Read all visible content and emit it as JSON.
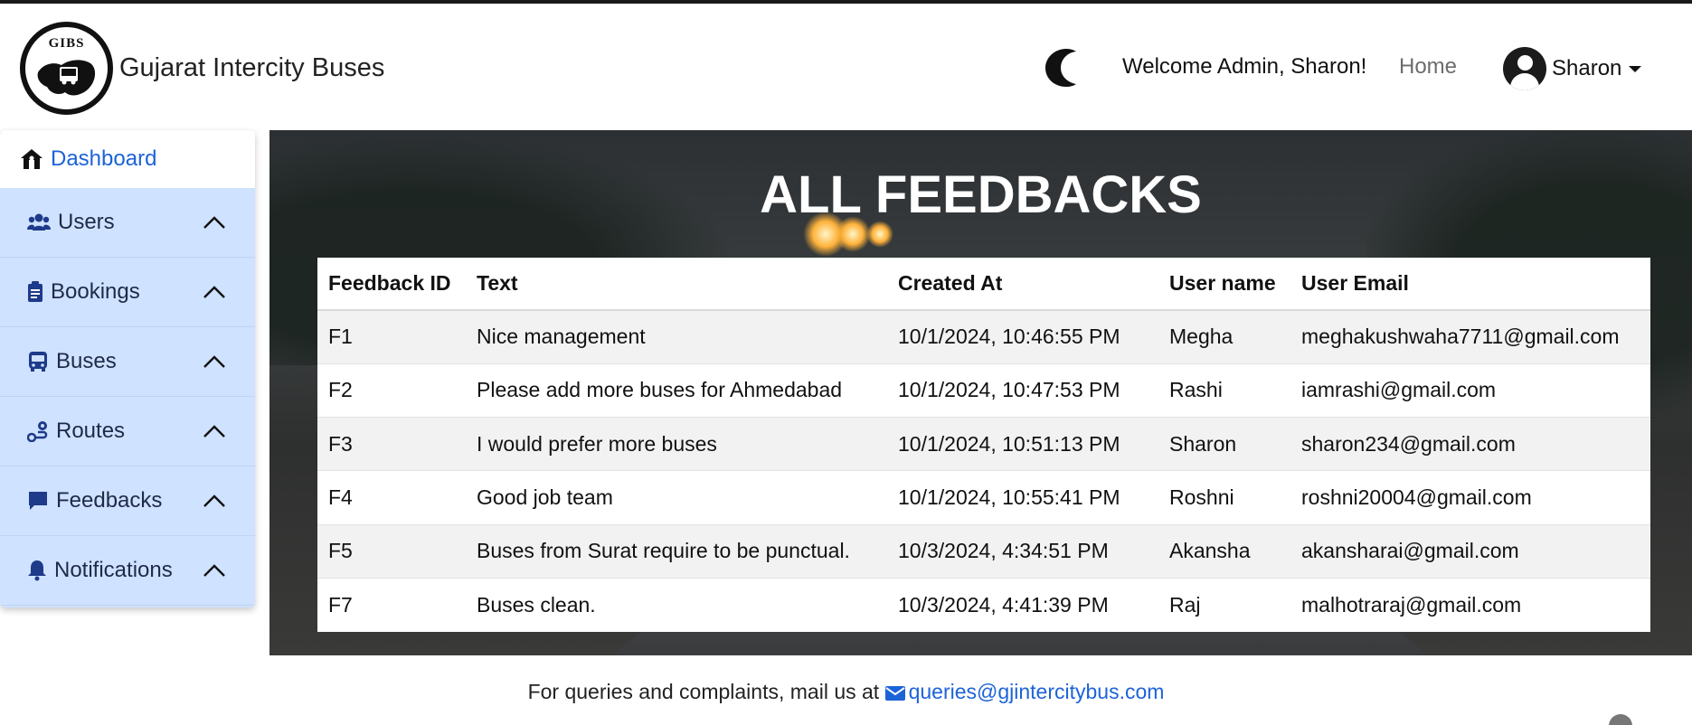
{
  "brand": {
    "logo_text": "GIBS",
    "name": "Gujarat Intercity Buses"
  },
  "nav": {
    "welcome": "Welcome Admin, Sharon!",
    "home": "Home",
    "user_name": "Sharon"
  },
  "sidebar": {
    "dashboard": "Dashboard",
    "items": [
      {
        "label": "Users",
        "icon": "users-icon"
      },
      {
        "label": "Bookings",
        "icon": "clipboard-icon"
      },
      {
        "label": "Buses",
        "icon": "bus-icon"
      },
      {
        "label": "Routes",
        "icon": "route-icon"
      },
      {
        "label": "Feedbacks",
        "icon": "comment-icon"
      },
      {
        "label": "Notifications",
        "icon": "bell-icon"
      }
    ]
  },
  "main": {
    "title": "ALL FEEDBACKS",
    "columns": [
      "Feedback ID",
      "Text",
      "Created At",
      "User name",
      "User Email"
    ],
    "rows": [
      [
        "F1",
        "Nice management",
        "10/1/2024, 10:46:55 PM",
        "Megha",
        "meghakushwaha7711@gmail.com"
      ],
      [
        "F2",
        "Please add more buses for Ahmedabad",
        "10/1/2024, 10:47:53 PM",
        "Rashi",
        "iamrashi@gmail.com"
      ],
      [
        "F3",
        "I would prefer more buses",
        "10/1/2024, 10:51:13 PM",
        "Sharon",
        "sharon234@gmail.com"
      ],
      [
        "F4",
        "Good job team",
        "10/1/2024, 10:55:41 PM",
        "Roshni",
        "roshni20004@gmail.com"
      ],
      [
        "F5",
        "Buses from Surat require to be punctual.",
        "10/3/2024, 4:34:51 PM",
        "Akansha",
        "akansharai@gmail.com"
      ],
      [
        "F7",
        "Buses clean.",
        "10/3/2024, 4:41:39 PM",
        "Raj",
        "malhotraraj@gmail.com"
      ]
    ]
  },
  "footer": {
    "text": "For queries and complaints, mail us at",
    "email": "queries@gjintercitybus.com"
  },
  "colors": {
    "accent": "#1c63d8",
    "sidebar_bg": "#cfe2ff"
  }
}
